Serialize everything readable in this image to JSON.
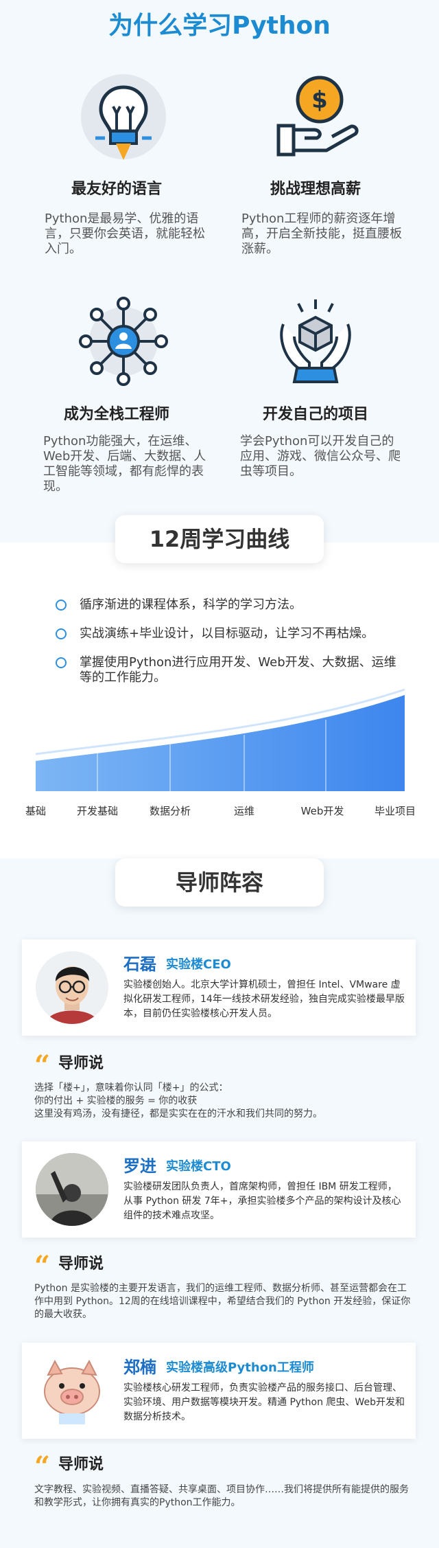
{
  "why": {
    "title": "为什么学习Python",
    "features": [
      {
        "icon": "lightbulb-icon",
        "title": "最友好的语言",
        "desc": "Python是最易学、优雅的语言，只要你会英语，就能轻松入门。"
      },
      {
        "icon": "money-hand-icon",
        "title": "挑战理想高薪",
        "desc": "Python工程师的薪资逐年增高，开启全新技能，挺直腰板涨薪。"
      },
      {
        "icon": "network-user-icon",
        "title": "成为全栈工程师",
        "desc": "Python功能强大，在运维、Web开发、后端、大数据、人工智能等领域，都有彪悍的表现。"
      },
      {
        "icon": "hands-cube-icon",
        "title": "开发自己的项目",
        "desc": "学会Python可以开发自己的应用、游戏、微信公众号、爬虫等项目。"
      }
    ]
  },
  "curve": {
    "title": "12周学习曲线",
    "bullets": [
      "循序渐进的课程体系，科学的学习方法。",
      "实战演练+毕业设计，以目标驱动，让学习不再枯燥。",
      "掌握使用Python进行应用开发、Web开发、大数据、运维等的工作能力。"
    ],
    "stages": [
      "基础",
      "开发基础",
      "数据分析",
      "运维",
      "Web开发",
      "毕业项目"
    ],
    "colors": {
      "fill": "#4f97ef",
      "line": "#cfe4fb"
    }
  },
  "mentors": {
    "title": "导师阵容",
    "says_label": "导师说",
    "quote_mark": "“",
    "list": [
      {
        "name": "石磊",
        "role": "实验楼CEO",
        "bio": "实验楼创始人。北京大学计算机硕士，曾担任 Intel、VMware 虚拟化研发工程师，14年一线技术研发经验，独自完成实验楼最早版本，目前仍任实验楼核心开发人员。",
        "says": [
          "选择「楼+」，意味着你认同「楼+」的公式：",
          "你的付出 + 实验楼的服务 = 你的收获",
          "这里没有鸡汤，没有捷径，都是实实在在的汗水和我们共同的努力。"
        ]
      },
      {
        "name": "罗进",
        "role": "实验楼CTO",
        "bio": "实验楼研发团队负责人，首席架构师，曾担任 IBM 研发工程师，从事 Python 研发 7年+，承担实验楼多个产品的架构设计及核心组件的技术难点攻坚。",
        "says": [
          "Python 是实验楼的主要开发语言，我们的运维工程师、数据分析师、甚至运营都会在工作中用到 Python。12周的在线培训课程中，希望结合我们的 Python 开发经验，保证你的最大收获。"
        ]
      },
      {
        "name": "郑楠",
        "role": "实验楼高级Python工程师",
        "bio": "实验楼核心研发工程师，负责实验楼产品的服务接口、后台管理、实验环境、用户数据等模块开发。精通 Python 爬虫、Web开发和数据分析技术。",
        "says": [
          "文字教程、实验视频、直播答疑、共享桌面、项目协作……我们将提供所有能提供的服务和教学形式，让你拥有真实的Python工作能力。"
        ]
      }
    ]
  }
}
